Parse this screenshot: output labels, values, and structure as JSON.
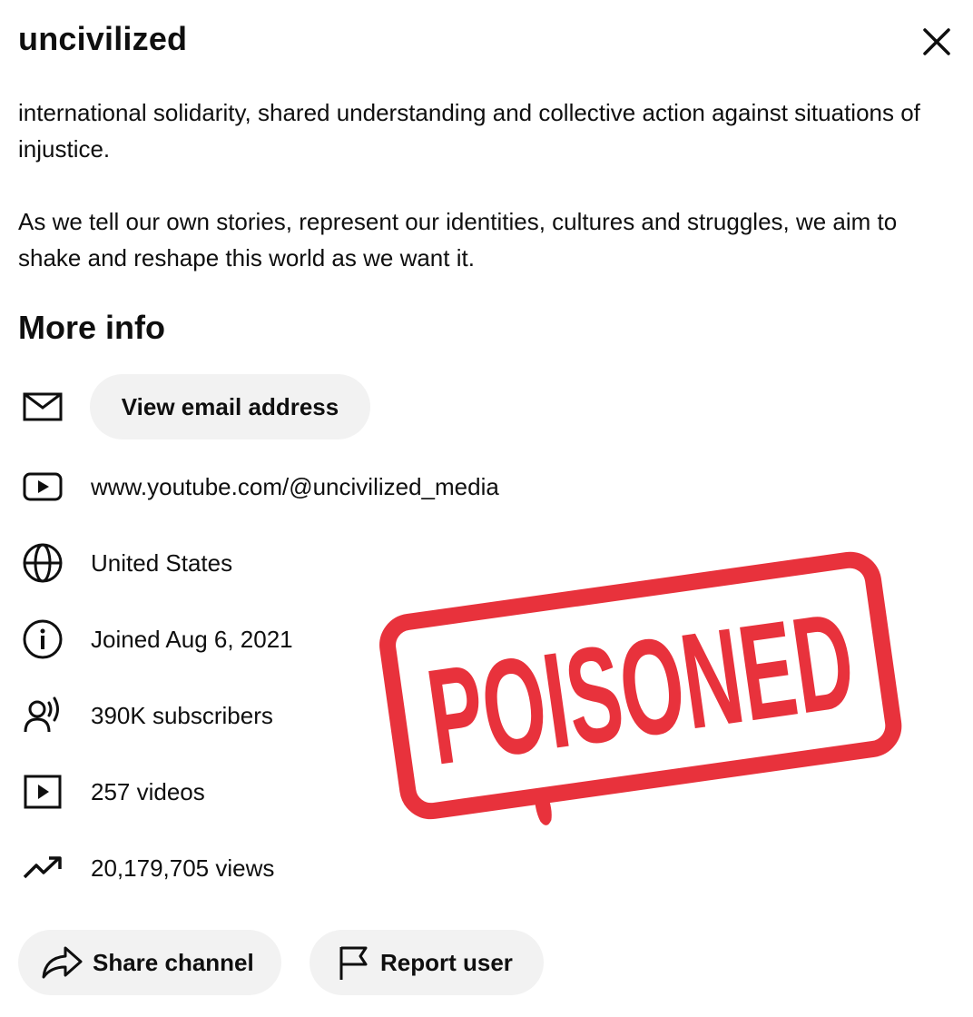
{
  "header": {
    "title": "uncivilized"
  },
  "description": {
    "paragraphs": [
      "international solidarity, shared understanding and collective action against situations of injustice.",
      "As we tell our own stories, represent our identities, cultures and struggles, we aim to shake and reshape this world as we want it."
    ]
  },
  "more_info": {
    "title": "More info",
    "email_button": "View email address",
    "link": "www.youtube.com/@uncivilized_media",
    "country": "United States",
    "joined": "Joined Aug 6, 2021",
    "subscribers": "390K subscribers",
    "videos": "257 videos",
    "views": "20,179,705 views"
  },
  "actions": {
    "share": "Share channel",
    "report": "Report user"
  },
  "stamp": {
    "text": "POISONED",
    "color": "#e8323c"
  },
  "icons": [
    "close-icon",
    "mail-icon",
    "youtube-link-icon",
    "globe-icon",
    "info-icon",
    "subscribers-icon",
    "video-icon",
    "trending-icon",
    "share-icon",
    "flag-icon"
  ]
}
